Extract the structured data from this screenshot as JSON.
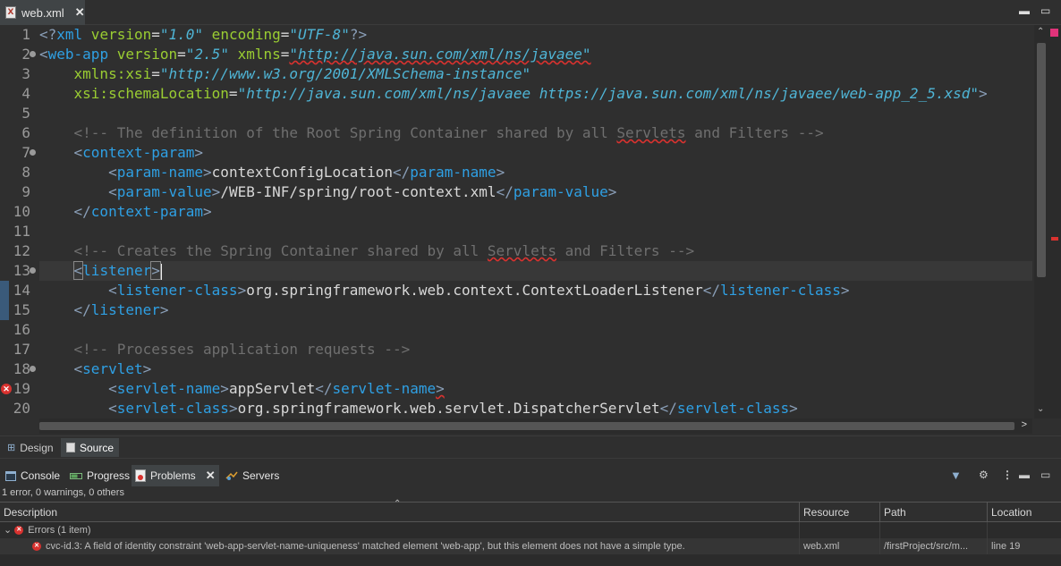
{
  "editor_tab": {
    "label": "web.xml",
    "file_icon": "X"
  },
  "window_controls": {
    "minimize": "▬",
    "maximize": "▭"
  },
  "gutter": {
    "lines": [
      "1",
      "2",
      "3",
      "4",
      "5",
      "6",
      "7",
      "8",
      "9",
      "10",
      "11",
      "12",
      "13",
      "14",
      "15",
      "16",
      "17",
      "18",
      "19",
      "20"
    ]
  },
  "code": {
    "l1": {
      "a": "<?",
      "b": "xml",
      "c": " version",
      "d": "=",
      "e": "\"1.0\"",
      "f": " encoding",
      "g": "=",
      "h": "\"UTF-8\"",
      "i": "?>"
    },
    "l2": {
      "a": "<",
      "b": "web-app",
      "c": " version",
      "d": "=",
      "e": "\"2.5\"",
      "f": " xmlns",
      "g": "=",
      "h": "\"http://java.sun.com/xml/ns/javaee\""
    },
    "l3": {
      "a": "xmlns:xsi",
      "b": "=",
      "c": "\"http://www.w3.org/2001/XMLSchema-instance\""
    },
    "l4": {
      "a": "xsi:schemaLocation",
      "b": "=",
      "c": "\"http://java.sun.com/xml/ns/javaee https://java.sun.com/xml/ns/javaee/web-app_2_5.xsd\"",
      "d": ">"
    },
    "l6": {
      "a": "<!-- The definition of the Root Spring Container shared by all ",
      "b": "Servlets",
      "c": " and Filters -->"
    },
    "l7": {
      "a": "<",
      "b": "context-param",
      "c": ">"
    },
    "l8": {
      "a": "<",
      "b": "param-name",
      "c": ">",
      "d": "contextConfigLocation",
      "e": "</",
      "f": "param-name",
      "g": ">"
    },
    "l9": {
      "a": "<",
      "b": "param-value",
      "c": ">",
      "d": "/WEB-INF/spring/root-context.xml",
      "e": "</",
      "f": "param-value",
      "g": ">"
    },
    "l10": {
      "a": "</",
      "b": "context-param",
      "c": ">"
    },
    "l12": {
      "a": "<!-- Creates the Spring Container shared by all ",
      "b": "Servlets",
      "c": " and Filters -->"
    },
    "l13": {
      "a": "<",
      "b": "listener",
      "c": ">"
    },
    "l14": {
      "a": "<",
      "b": "listener-class",
      "c": ">",
      "d": "org.springframework.web.context.ContextLoaderListener",
      "e": "</",
      "f": "listener-class",
      "g": ">"
    },
    "l15": {
      "a": "</",
      "b": "listener",
      "c": ">"
    },
    "l17": {
      "a": "<!-- Processes application requests -->"
    },
    "l18": {
      "a": "<",
      "b": "servlet",
      "c": ">"
    },
    "l19": {
      "a": "<",
      "b": "servlet-name",
      "c": ">",
      "d": "appServlet",
      "e": "</",
      "f": "servlet-name",
      "g": ">"
    },
    "l20": {
      "a": "<",
      "b": "servlet-class",
      "c": ">",
      "d": "org.springframework.web.servlet.DispatcherServlet",
      "e": "</",
      "f": "servlet-class",
      "g": ">"
    }
  },
  "editor_mode_tabs": {
    "design": "Design",
    "source": "Source"
  },
  "view_tabs": {
    "console": "Console",
    "progress": "Progress",
    "problems": "Problems",
    "servers": "Servers"
  },
  "view_toolbar": {
    "filter": "▼",
    "menu": "⋮",
    "minimize": "▬",
    "maximize": "▭"
  },
  "problems": {
    "summary": "1 error, 0 warnings, 0 others",
    "columns": {
      "description": "Description",
      "resource": "Resource",
      "path": "Path",
      "location": "Location"
    },
    "group": {
      "label": "Errors (1 item)",
      "expander": "⌄"
    },
    "items": [
      {
        "description": "cvc-id.3: A field of identity constraint 'web-app-servlet-name-uniqueness' matched element 'web-app', but this element does not have a simple type.",
        "resource": "web.xml",
        "path": "/firstProject/src/m...",
        "location": "line 19"
      }
    ]
  },
  "colors": {
    "error": "#d9322f",
    "tag": "#2fa0e4",
    "attr": "#9acd32",
    "value": "#4fb5d6",
    "comment": "#6f6f6f",
    "background": "#2f2f2f"
  }
}
